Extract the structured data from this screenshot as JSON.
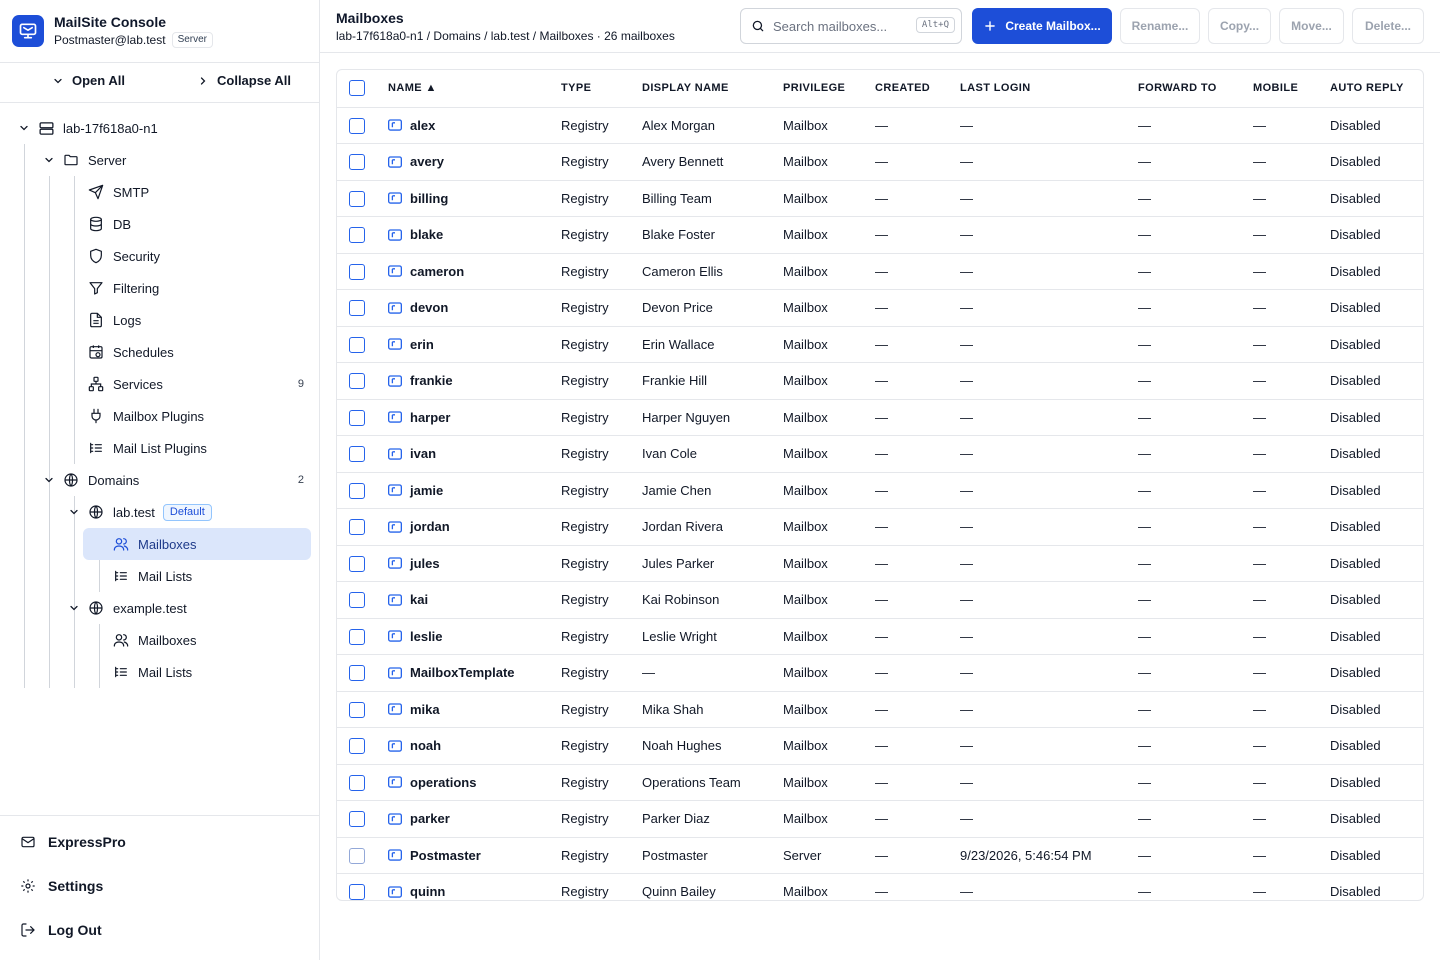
{
  "app": {
    "title": "MailSite Console",
    "user": "Postmaster@lab.test",
    "role_badge": "Server"
  },
  "tree_actions": {
    "open_all": "Open All",
    "collapse_all": "Collapse All"
  },
  "tree": {
    "host": "lab-17f618a0-n1",
    "server": "Server",
    "server_items": [
      "SMTP",
      "DB",
      "Security",
      "Filtering",
      "Logs",
      "Schedules",
      "Services",
      "Mailbox Plugins",
      "Mail List Plugins"
    ],
    "services_count": "9",
    "domains": "Domains",
    "domains_count": "2",
    "domain1": "lab.test",
    "domain1_badge": "Default",
    "domain1_mailboxes": "Mailboxes",
    "domain1_maillists": "Mail Lists",
    "domain2": "example.test",
    "domain2_mailboxes": "Mailboxes",
    "domain2_maillists": "Mail Lists"
  },
  "sidebar_bottom": {
    "expresspro": "ExpressPro",
    "settings": "Settings",
    "logout": "Log Out"
  },
  "header": {
    "title": "Mailboxes",
    "breadcrumb": "lab-17f618a0-n1 / Domains / lab.test / Mailboxes · 26 mailboxes",
    "search_placeholder": "Search mailboxes...",
    "search_shortcut": "Alt+Q",
    "create": "Create Mailbox...",
    "rename": "Rename...",
    "copy": "Copy...",
    "move": "Move...",
    "delete": "Delete..."
  },
  "table": {
    "columns": [
      "NAME ▲",
      "TYPE",
      "DISPLAY NAME",
      "PRIVILEGE",
      "CREATED",
      "LAST LOGIN",
      "FORWARD TO",
      "MOBILE",
      "AUTO REPLY"
    ],
    "rows": [
      [
        "alex",
        "Registry",
        "Alex Morgan",
        "Mailbox",
        "—",
        "—",
        "—",
        "—",
        "Disabled"
      ],
      [
        "avery",
        "Registry",
        "Avery Bennett",
        "Mailbox",
        "—",
        "—",
        "—",
        "—",
        "Disabled"
      ],
      [
        "billing",
        "Registry",
        "Billing Team",
        "Mailbox",
        "—",
        "—",
        "—",
        "—",
        "Disabled"
      ],
      [
        "blake",
        "Registry",
        "Blake Foster",
        "Mailbox",
        "—",
        "—",
        "—",
        "—",
        "Disabled"
      ],
      [
        "cameron",
        "Registry",
        "Cameron Ellis",
        "Mailbox",
        "—",
        "—",
        "—",
        "—",
        "Disabled"
      ],
      [
        "devon",
        "Registry",
        "Devon Price",
        "Mailbox",
        "—",
        "—",
        "—",
        "—",
        "Disabled"
      ],
      [
        "erin",
        "Registry",
        "Erin Wallace",
        "Mailbox",
        "—",
        "—",
        "—",
        "—",
        "Disabled"
      ],
      [
        "frankie",
        "Registry",
        "Frankie Hill",
        "Mailbox",
        "—",
        "—",
        "—",
        "—",
        "Disabled"
      ],
      [
        "harper",
        "Registry",
        "Harper Nguyen",
        "Mailbox",
        "—",
        "—",
        "—",
        "—",
        "Disabled"
      ],
      [
        "ivan",
        "Registry",
        "Ivan Cole",
        "Mailbox",
        "—",
        "—",
        "—",
        "—",
        "Disabled"
      ],
      [
        "jamie",
        "Registry",
        "Jamie Chen",
        "Mailbox",
        "—",
        "—",
        "—",
        "—",
        "Disabled"
      ],
      [
        "jordan",
        "Registry",
        "Jordan Rivera",
        "Mailbox",
        "—",
        "—",
        "—",
        "—",
        "Disabled"
      ],
      [
        "jules",
        "Registry",
        "Jules Parker",
        "Mailbox",
        "—",
        "—",
        "—",
        "—",
        "Disabled"
      ],
      [
        "kai",
        "Registry",
        "Kai Robinson",
        "Mailbox",
        "—",
        "—",
        "—",
        "—",
        "Disabled"
      ],
      [
        "leslie",
        "Registry",
        "Leslie Wright",
        "Mailbox",
        "—",
        "—",
        "—",
        "—",
        "Disabled"
      ],
      [
        "MailboxTemplate",
        "Registry",
        "—",
        "Mailbox",
        "—",
        "—",
        "—",
        "—",
        "Disabled"
      ],
      [
        "mika",
        "Registry",
        "Mika Shah",
        "Mailbox",
        "—",
        "—",
        "—",
        "—",
        "Disabled"
      ],
      [
        "noah",
        "Registry",
        "Noah Hughes",
        "Mailbox",
        "—",
        "—",
        "—",
        "—",
        "Disabled"
      ],
      [
        "operations",
        "Registry",
        "Operations Team",
        "Mailbox",
        "—",
        "—",
        "—",
        "—",
        "Disabled"
      ],
      [
        "parker",
        "Registry",
        "Parker Diaz",
        "Mailbox",
        "—",
        "—",
        "—",
        "—",
        "Disabled"
      ],
      [
        "Postmaster",
        "Registry",
        "Postmaster",
        "Server",
        "—",
        "9/23/2026, 5:46:54 PM",
        "—",
        "—",
        "Disabled"
      ],
      [
        "quinn",
        "Registry",
        "Quinn Bailey",
        "Mailbox",
        "—",
        "—",
        "—",
        "—",
        "Disabled"
      ]
    ]
  },
  "colors": {
    "accent": "#1d4ed8",
    "selected": "#dbe6fb"
  }
}
